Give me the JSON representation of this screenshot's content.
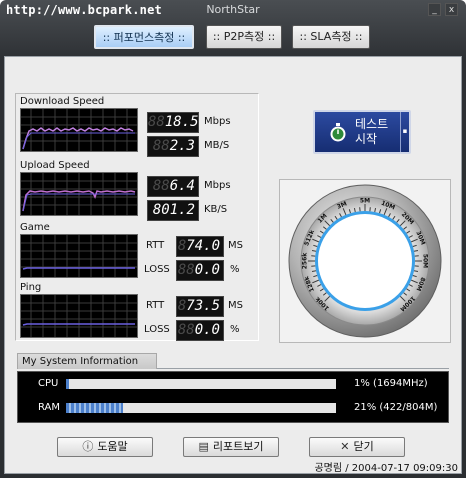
{
  "titlebar": {
    "watermark": "http://www.bcpark.net",
    "app_title": "NorthStar",
    "minimize": "_",
    "close": "x"
  },
  "tabs": [
    {
      "label": ":: 퍼포먼스측정 ::",
      "active": true
    },
    {
      "label": ":: P2P측정 ::",
      "active": false
    },
    {
      "label": ":: SLA측정 ::",
      "active": false
    }
  ],
  "monitor": {
    "download": {
      "title": "Download Speed",
      "ghost1": "88",
      "value1": "18.5",
      "unit1": "Mbps",
      "ghost2": "88",
      "value2": "2.3",
      "unit2": "MB/S"
    },
    "upload": {
      "title": "Upload Speed",
      "ghost1": "88",
      "value1": "6.4",
      "unit1": "Mbps",
      "ghost2": "",
      "value2": "801.2",
      "unit2": "KB/S"
    },
    "game": {
      "title": "Game",
      "rtt_label": "RTT",
      "rtt_ghost": "8",
      "rtt_value": "74.0",
      "rtt_unit": "MS",
      "loss_label": "LOSS",
      "loss_ghost": "88",
      "loss_value": "0.0",
      "loss_unit": "%"
    },
    "ping": {
      "title": "Ping",
      "rtt_label": "RTT",
      "rtt_ghost": "8",
      "rtt_value": "73.5",
      "rtt_unit": "MS",
      "loss_label": "LOSS",
      "loss_ghost": "88",
      "loss_value": "0.0",
      "loss_unit": "%"
    }
  },
  "start_button": {
    "line1": "테스트",
    "line2": "시작",
    "icon": "stopwatch-icon"
  },
  "gauge": {
    "tick_labels": [
      "100k",
      "128k",
      "256k",
      "512k",
      "1M",
      "3M",
      "5M",
      "10M",
      "20M",
      "30M",
      "50M",
      "80M",
      "100M"
    ]
  },
  "system_info": {
    "title": "My System Information",
    "cpu": {
      "label": "CPU",
      "percent": 1,
      "value": "1% (1694MHz)"
    },
    "ram": {
      "label": "RAM",
      "percent": 21,
      "value": "21% (422/804M)"
    }
  },
  "footer": {
    "help_label": "도움말",
    "report_label": "리포트보기",
    "close_label": "닫기",
    "status": "공명림 / 2004-07-17 09:09:30"
  },
  "colors": {
    "scope_grid": "#3a3a3a",
    "download_trace": "#c080e0",
    "upload_trace": "#c070d0",
    "flat_trace": "#6a60e0",
    "button_blue": "#1f3c8e"
  }
}
